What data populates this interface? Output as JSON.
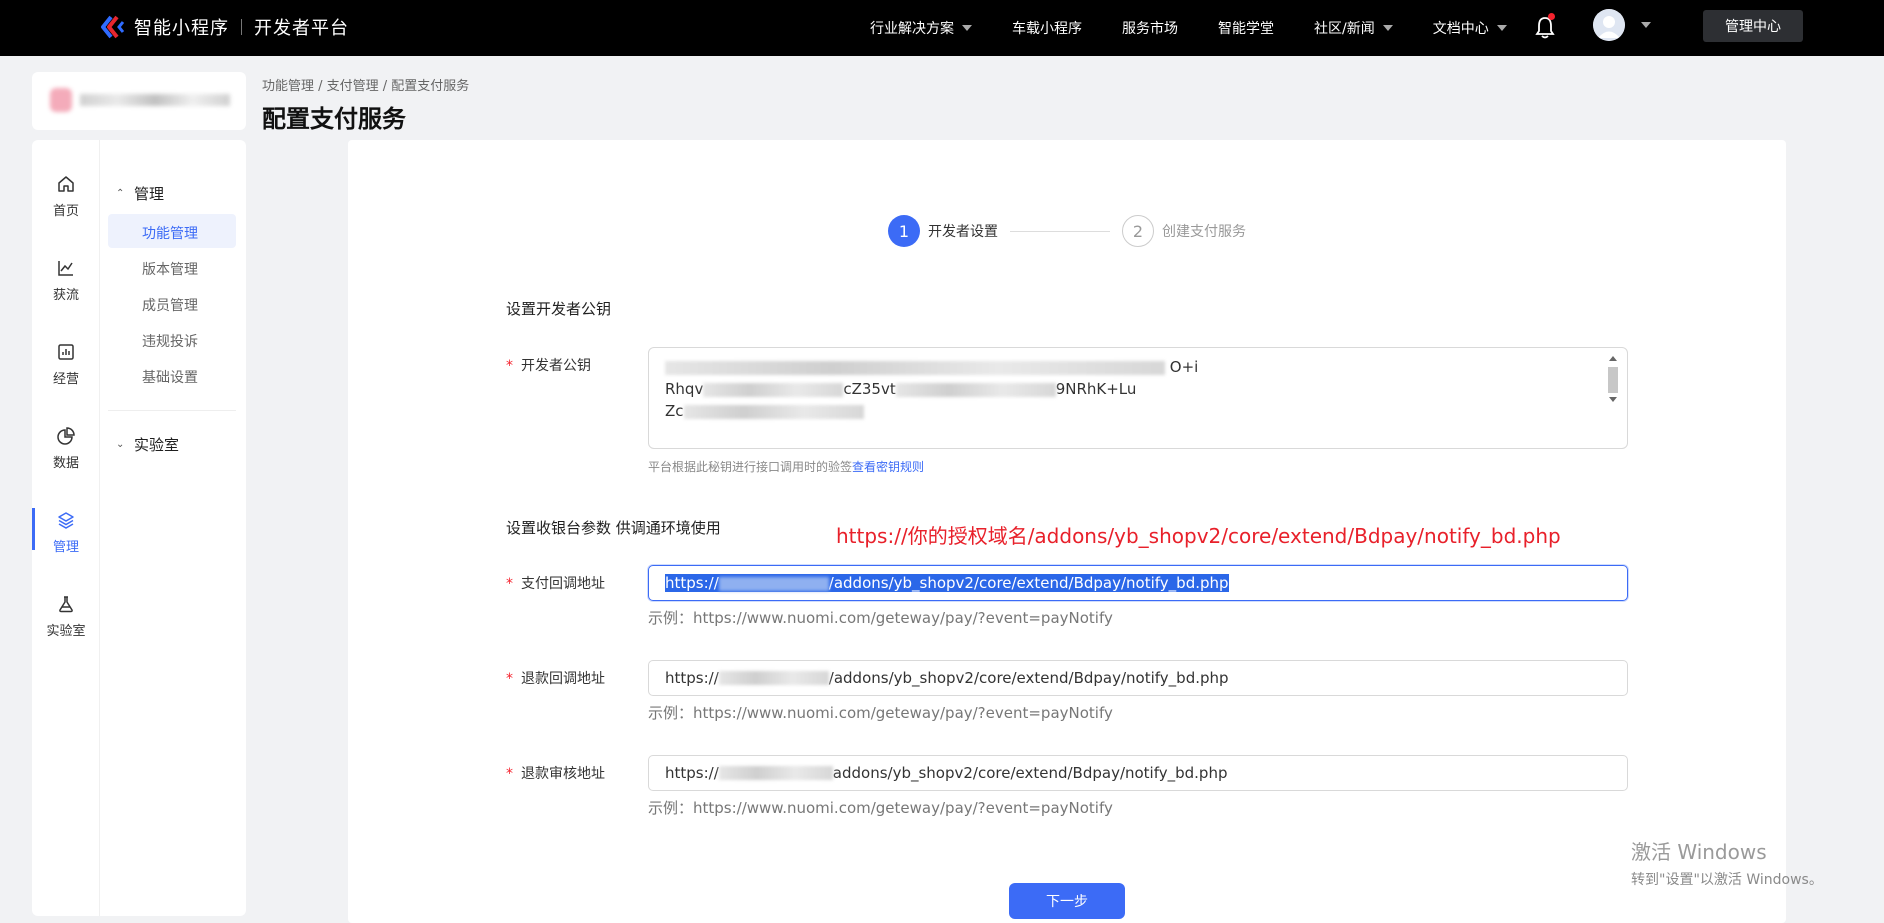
{
  "topbar": {
    "brand": "智能小程序",
    "platform": "开发者平台",
    "nav": [
      {
        "label": "行业解决方案",
        "dropdown": true
      },
      {
        "label": "车载小程序",
        "dropdown": false
      },
      {
        "label": "服务市场",
        "dropdown": false
      },
      {
        "label": "智能学堂",
        "dropdown": false
      },
      {
        "label": "社区/新闻",
        "dropdown": true
      },
      {
        "label": "文档中心",
        "dropdown": true
      }
    ],
    "admin_label": "管理中心"
  },
  "rail": [
    {
      "label": "首页",
      "icon": "home-icon"
    },
    {
      "label": "获流",
      "icon": "trend-chart-icon"
    },
    {
      "label": "经营",
      "icon": "bar-chart-icon"
    },
    {
      "label": "数据",
      "icon": "pie-chart-icon"
    },
    {
      "label": "管理",
      "icon": "layers-icon",
      "active": true
    },
    {
      "label": "实验室",
      "icon": "flask-icon"
    }
  ],
  "submenu": {
    "group1": "管理",
    "items": [
      "功能管理",
      "版本管理",
      "成员管理",
      "违规投诉",
      "基础设置"
    ],
    "group2": "实验室"
  },
  "breadcrumb": "功能管理 / 支付管理 / 配置支付服务",
  "page_title": "配置支付服务",
  "steps": [
    {
      "num": "1",
      "label": "开发者设置",
      "active": true
    },
    {
      "num": "2",
      "label": "创建支付服务",
      "active": false
    }
  ],
  "section1": {
    "title": "设置开发者公钥",
    "field_label": "开发者公钥",
    "key_lines": [
      "Rhqv",
      "Zc"
    ],
    "key_fragments": [
      "O+i",
      "cZ35vt",
      "9NRhK+Lu"
    ],
    "hint": "平台根据此秘钥进行接口调用时的验签",
    "hint_link": "查看密钥规则"
  },
  "annotation": "https://你的授权域名/addons/yb_shopv2/core/extend/Bdpay/notify_bd.php",
  "section2": {
    "title": "设置收银台参数 供调通环境使用",
    "fields": [
      {
        "label": "支付回调地址",
        "prefix": "https://",
        "suffix": "/addons/yb_shopv2/core/extend/Bdpay/notify_bd.php",
        "example": "示例：https://www.nuomi.com/geteway/pay/?event=payNotify"
      },
      {
        "label": "退款回调地址",
        "prefix": "https://",
        "suffix": "/addons/yb_shopv2/core/extend/Bdpay/notify_bd.php",
        "example": "示例：https://www.nuomi.com/geteway/pay/?event=payNotify"
      },
      {
        "label": "退款审核地址",
        "prefix": "https://",
        "suffix": "addons/yb_shopv2/core/extend/Bdpay/notify_bd.php",
        "example": "示例：https://www.nuomi.com/geteway/pay/?event=payNotify"
      }
    ]
  },
  "next_label": "下一步",
  "watermark": {
    "line1": "激活 Windows",
    "line2": "转到\"设置\"以激活 Windows。"
  },
  "colors": {
    "primary": "#3c6bf6",
    "annotation": "#e8202a",
    "required": "#f5222d"
  }
}
